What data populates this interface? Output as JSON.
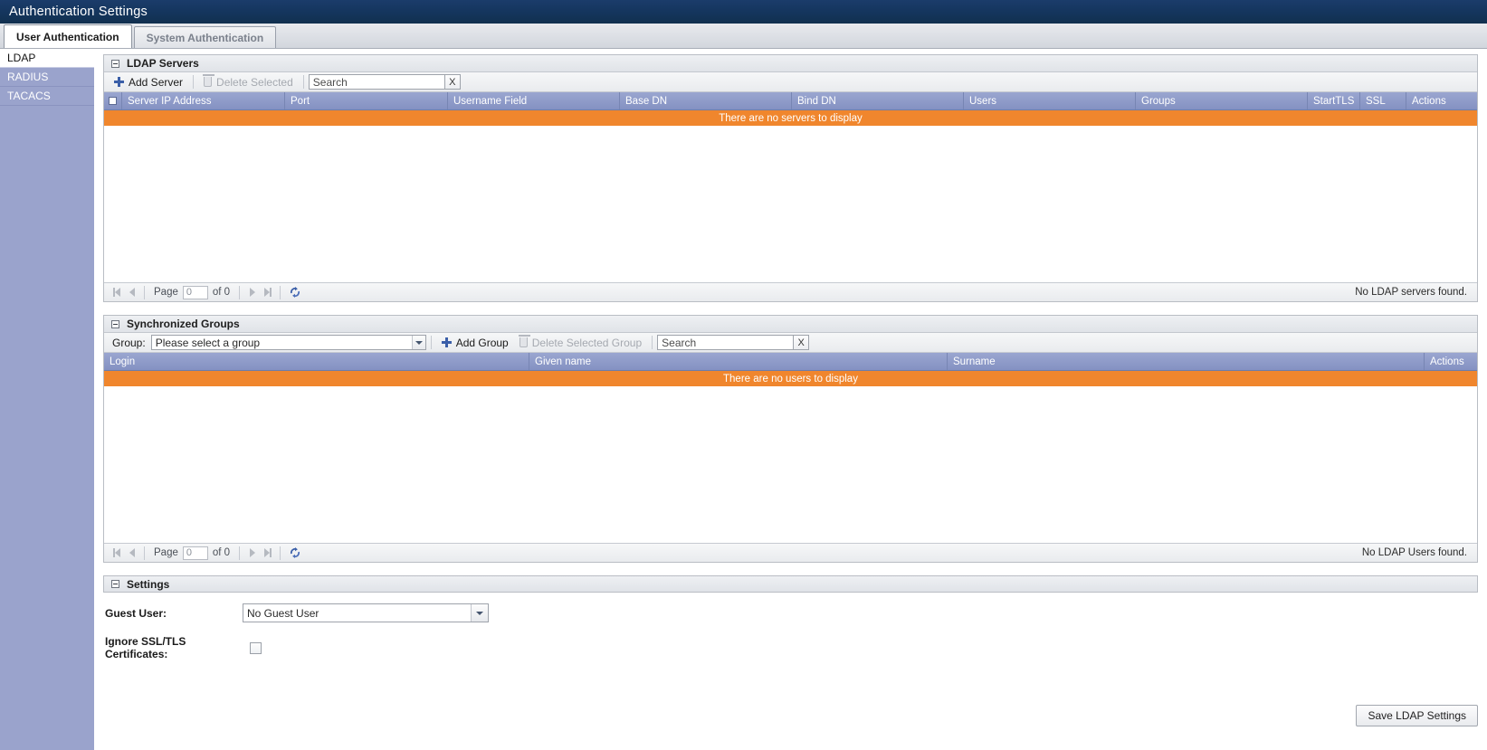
{
  "window": {
    "title": "Authentication Settings"
  },
  "tabs": [
    {
      "label": "User Authentication",
      "active": true
    },
    {
      "label": "System Authentication",
      "active": false
    }
  ],
  "sidebar": {
    "items": [
      {
        "label": "LDAP",
        "active": true
      },
      {
        "label": "RADIUS",
        "active": false
      },
      {
        "label": "TACACS",
        "active": false
      }
    ]
  },
  "ldap_servers": {
    "panel_title": "LDAP Servers",
    "toolbar": {
      "add_label": "Add Server",
      "delete_label": "Delete Selected",
      "search_placeholder": "Search",
      "search_value": "",
      "clear_label": "X"
    },
    "columns": [
      "Server IP Address",
      "Port",
      "Username Field",
      "Base DN",
      "Bind DN",
      "Users",
      "Groups",
      "StartTLS",
      "SSL",
      "Actions"
    ],
    "empty_message": "There are no servers to display",
    "rows": [],
    "pager": {
      "page_label": "Page",
      "page_value": "0",
      "of_label": "of 0",
      "status": "No LDAP servers found."
    }
  },
  "synchronized_groups": {
    "panel_title": "Synchronized Groups",
    "toolbar": {
      "group_label": "Group:",
      "group_value": "Please select a group",
      "add_label": "Add Group",
      "delete_label": "Delete Selected Group",
      "search_placeholder": "Search",
      "search_value": "",
      "clear_label": "X"
    },
    "columns": [
      "Login",
      "Given name",
      "Surname",
      "Actions"
    ],
    "empty_message": "There are no users to display",
    "rows": [],
    "pager": {
      "page_label": "Page",
      "page_value": "0",
      "of_label": "of 0",
      "status": "No LDAP Users found."
    }
  },
  "settings": {
    "panel_title": "Settings",
    "guest_user_label": "Guest User:",
    "guest_user_value": "No Guest User",
    "ignore_ssl_label": "Ignore SSL/TLS Certificates:",
    "ignore_ssl_checked": false,
    "save_label": "Save LDAP Settings"
  },
  "colors": {
    "titlebar": "#15365f",
    "sidebar": "#9aa3cc",
    "grid_header": "#8491c2",
    "empty_row": "#f0862d",
    "accent_blue": "#3a5ea8"
  }
}
